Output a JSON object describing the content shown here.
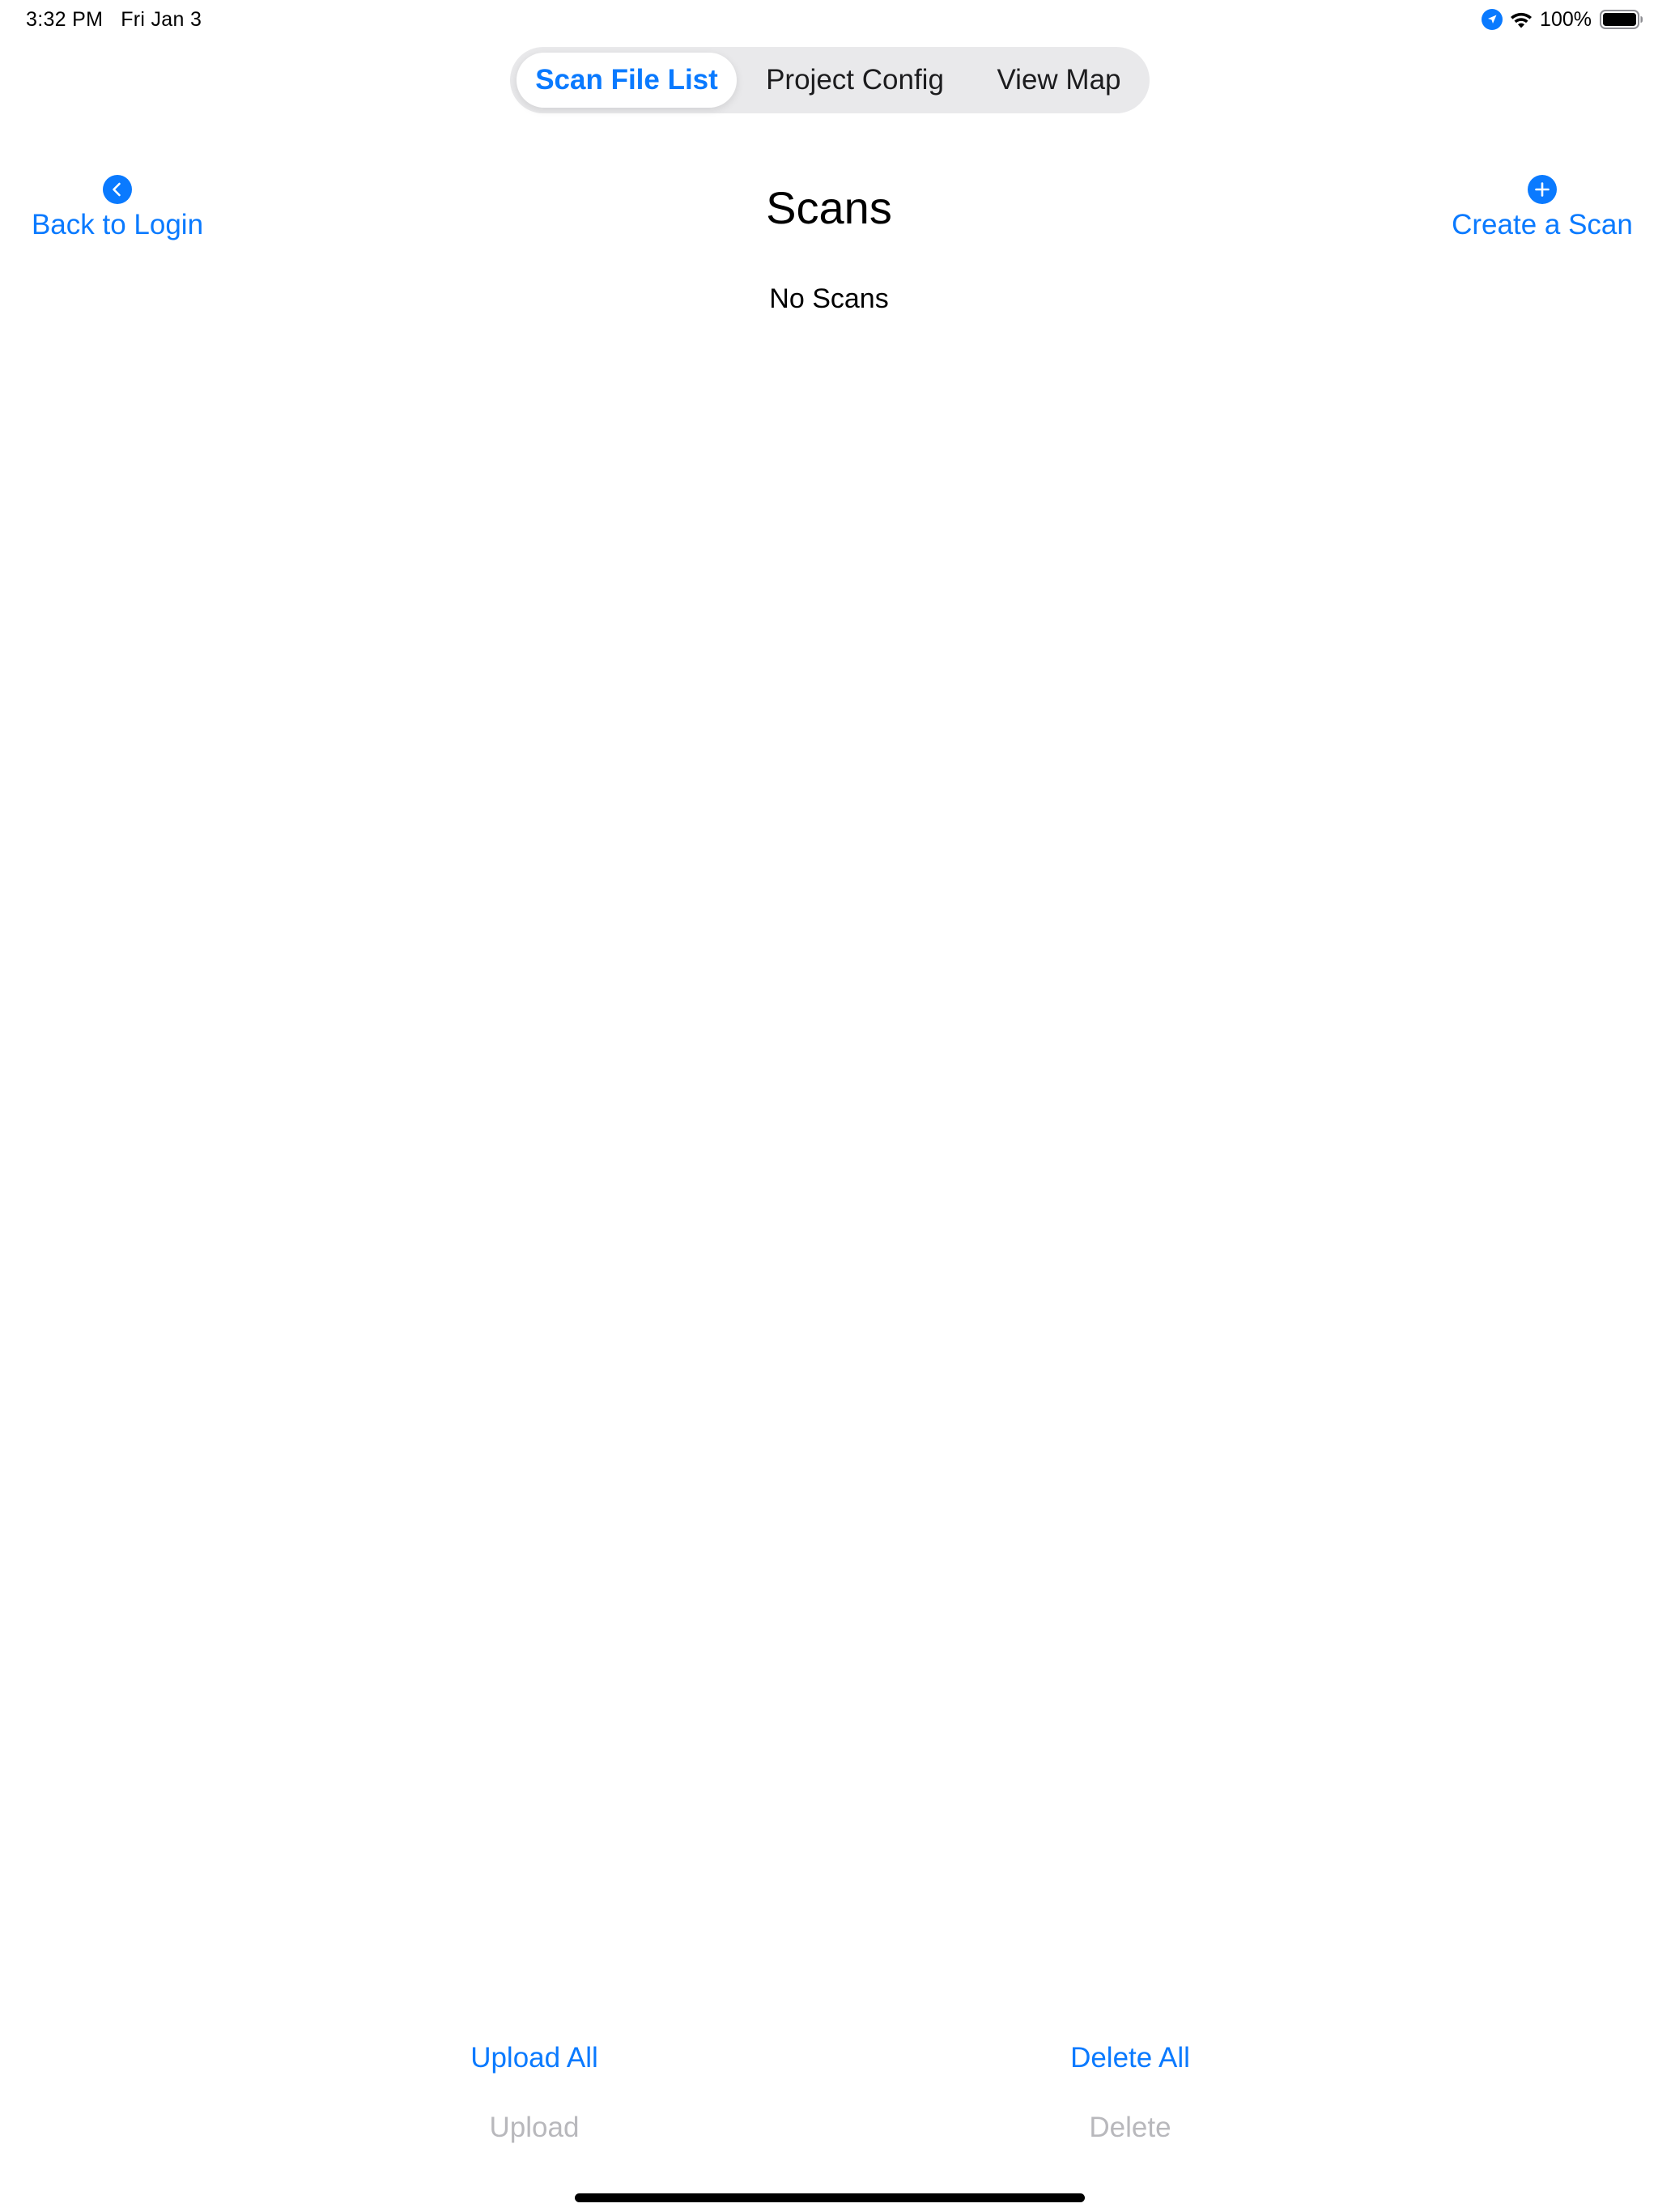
{
  "status_bar": {
    "time": "3:32 PM",
    "date": "Fri Jan 3",
    "battery_percent": "100%",
    "icons": [
      "location-icon",
      "wifi-icon",
      "battery-icon"
    ]
  },
  "tabs": [
    {
      "label": "Scan File List",
      "selected": true
    },
    {
      "label": "Project Config",
      "selected": false
    },
    {
      "label": "View Map",
      "selected": false
    }
  ],
  "header": {
    "back_label": "Back to Login",
    "back_icon": "chevron-left-icon",
    "title": "Scans",
    "create_label": "Create a Scan",
    "create_icon": "plus-circle-icon"
  },
  "content": {
    "empty_message": "No Scans"
  },
  "actions": {
    "upload_all": "Upload All",
    "delete_all": "Delete All",
    "upload": "Upload",
    "delete": "Delete"
  },
  "colors": {
    "accent": "#0a7aff",
    "disabled": "#b8b8bc",
    "segment_background": "#e9e9eb"
  }
}
